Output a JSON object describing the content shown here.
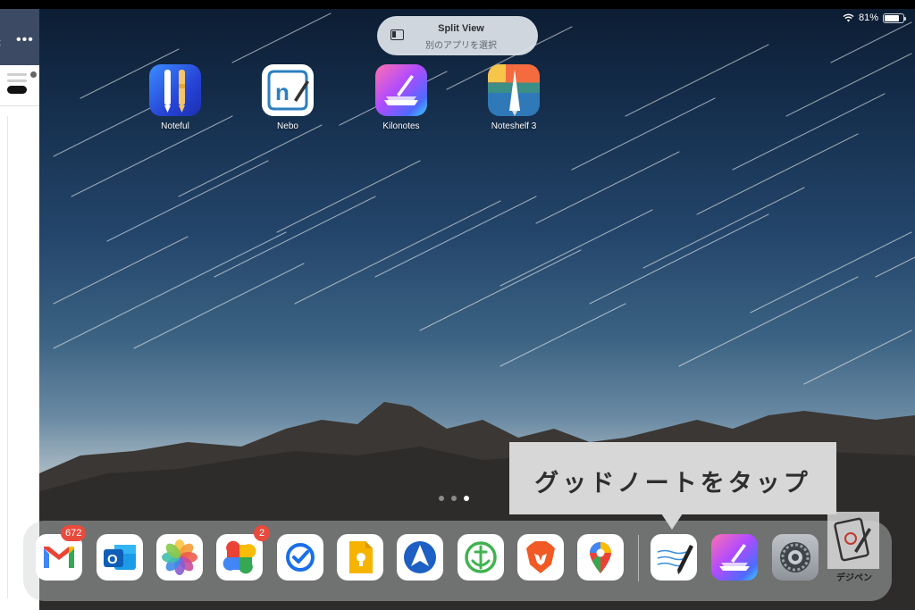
{
  "status_bar": {
    "wifi_icon": "wifi-icon",
    "battery_text": "81%"
  },
  "split_view": {
    "title": "Split View",
    "subtitle": "別のアプリを選択"
  },
  "side_panel": {
    "back_icon": "‹",
    "more_icon": "•••"
  },
  "home_apps": [
    {
      "name": "Noteful"
    },
    {
      "name": "Nebo"
    },
    {
      "name": "Kilonotes"
    },
    {
      "name": "Noteshelf 3"
    }
  ],
  "callout": {
    "text": "グッドノートをタップ"
  },
  "dock": {
    "badges": {
      "gmail": "672",
      "google_photos": "2"
    },
    "apps": [
      "Gmail",
      "Outlook",
      "Photos",
      "Google Photos",
      "Tasks",
      "Keep",
      "Navigation",
      "Anchor",
      "Brave",
      "Google Maps",
      "GoodNotes",
      "Kilonotes",
      "Settings"
    ]
  },
  "watermark": {
    "text": "デジペン"
  },
  "page_dots": {
    "count": 3,
    "active": 3
  },
  "colors": {
    "panel_header": "#3d4a63",
    "badge": "#e84a3c",
    "callout_bg": "#d7d7d7"
  }
}
